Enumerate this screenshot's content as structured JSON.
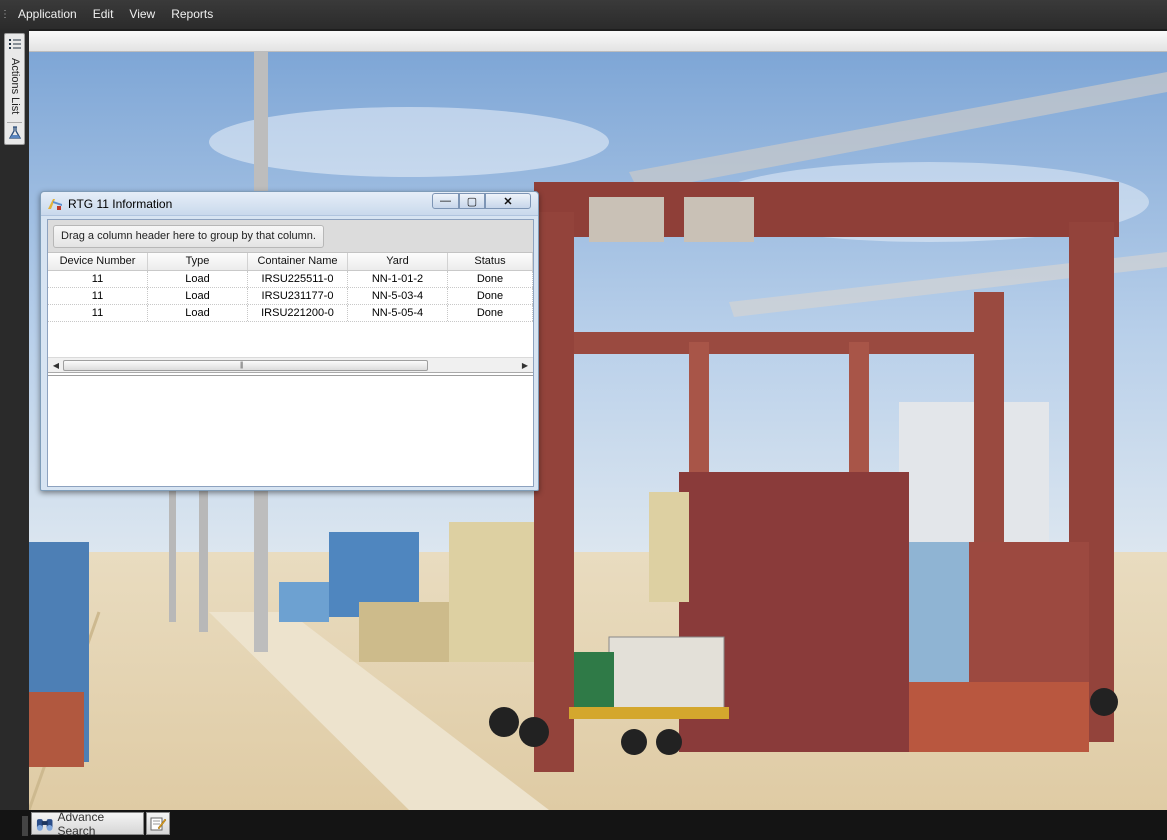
{
  "menubar": {
    "items": [
      "Application",
      "Edit",
      "View",
      "Reports"
    ]
  },
  "dock": {
    "actions_list_label": "Actions List",
    "icons": [
      "list-icon",
      "flask-icon"
    ]
  },
  "window": {
    "title": "RTG 11 Information",
    "controls": {
      "minimize": "—",
      "maximize": "▢",
      "close": "✕"
    },
    "group_hint": "Drag a column header here to group by that column.",
    "columns": [
      "Device Number",
      "Type",
      "Container Name",
      "Yard",
      "Status"
    ],
    "rows": [
      [
        "11",
        "Load",
        "IRSU225511-0",
        "NN-1-01-2",
        "Done"
      ],
      [
        "11",
        "Load",
        "IRSU231177-0",
        "NN-5-03-4",
        "Done"
      ],
      [
        "11",
        "Load",
        "IRSU221200-0",
        "NN-5-05-4",
        "Done"
      ]
    ]
  },
  "bottombar": {
    "advance_search_label": "Advance Search"
  },
  "colors": {
    "menubar_bg": "#2f2f2f",
    "window_frame": "#d7e4f2",
    "sky": "#8fb6df",
    "ground": "#e8d9b5",
    "crane_red": "#8d3a34"
  }
}
